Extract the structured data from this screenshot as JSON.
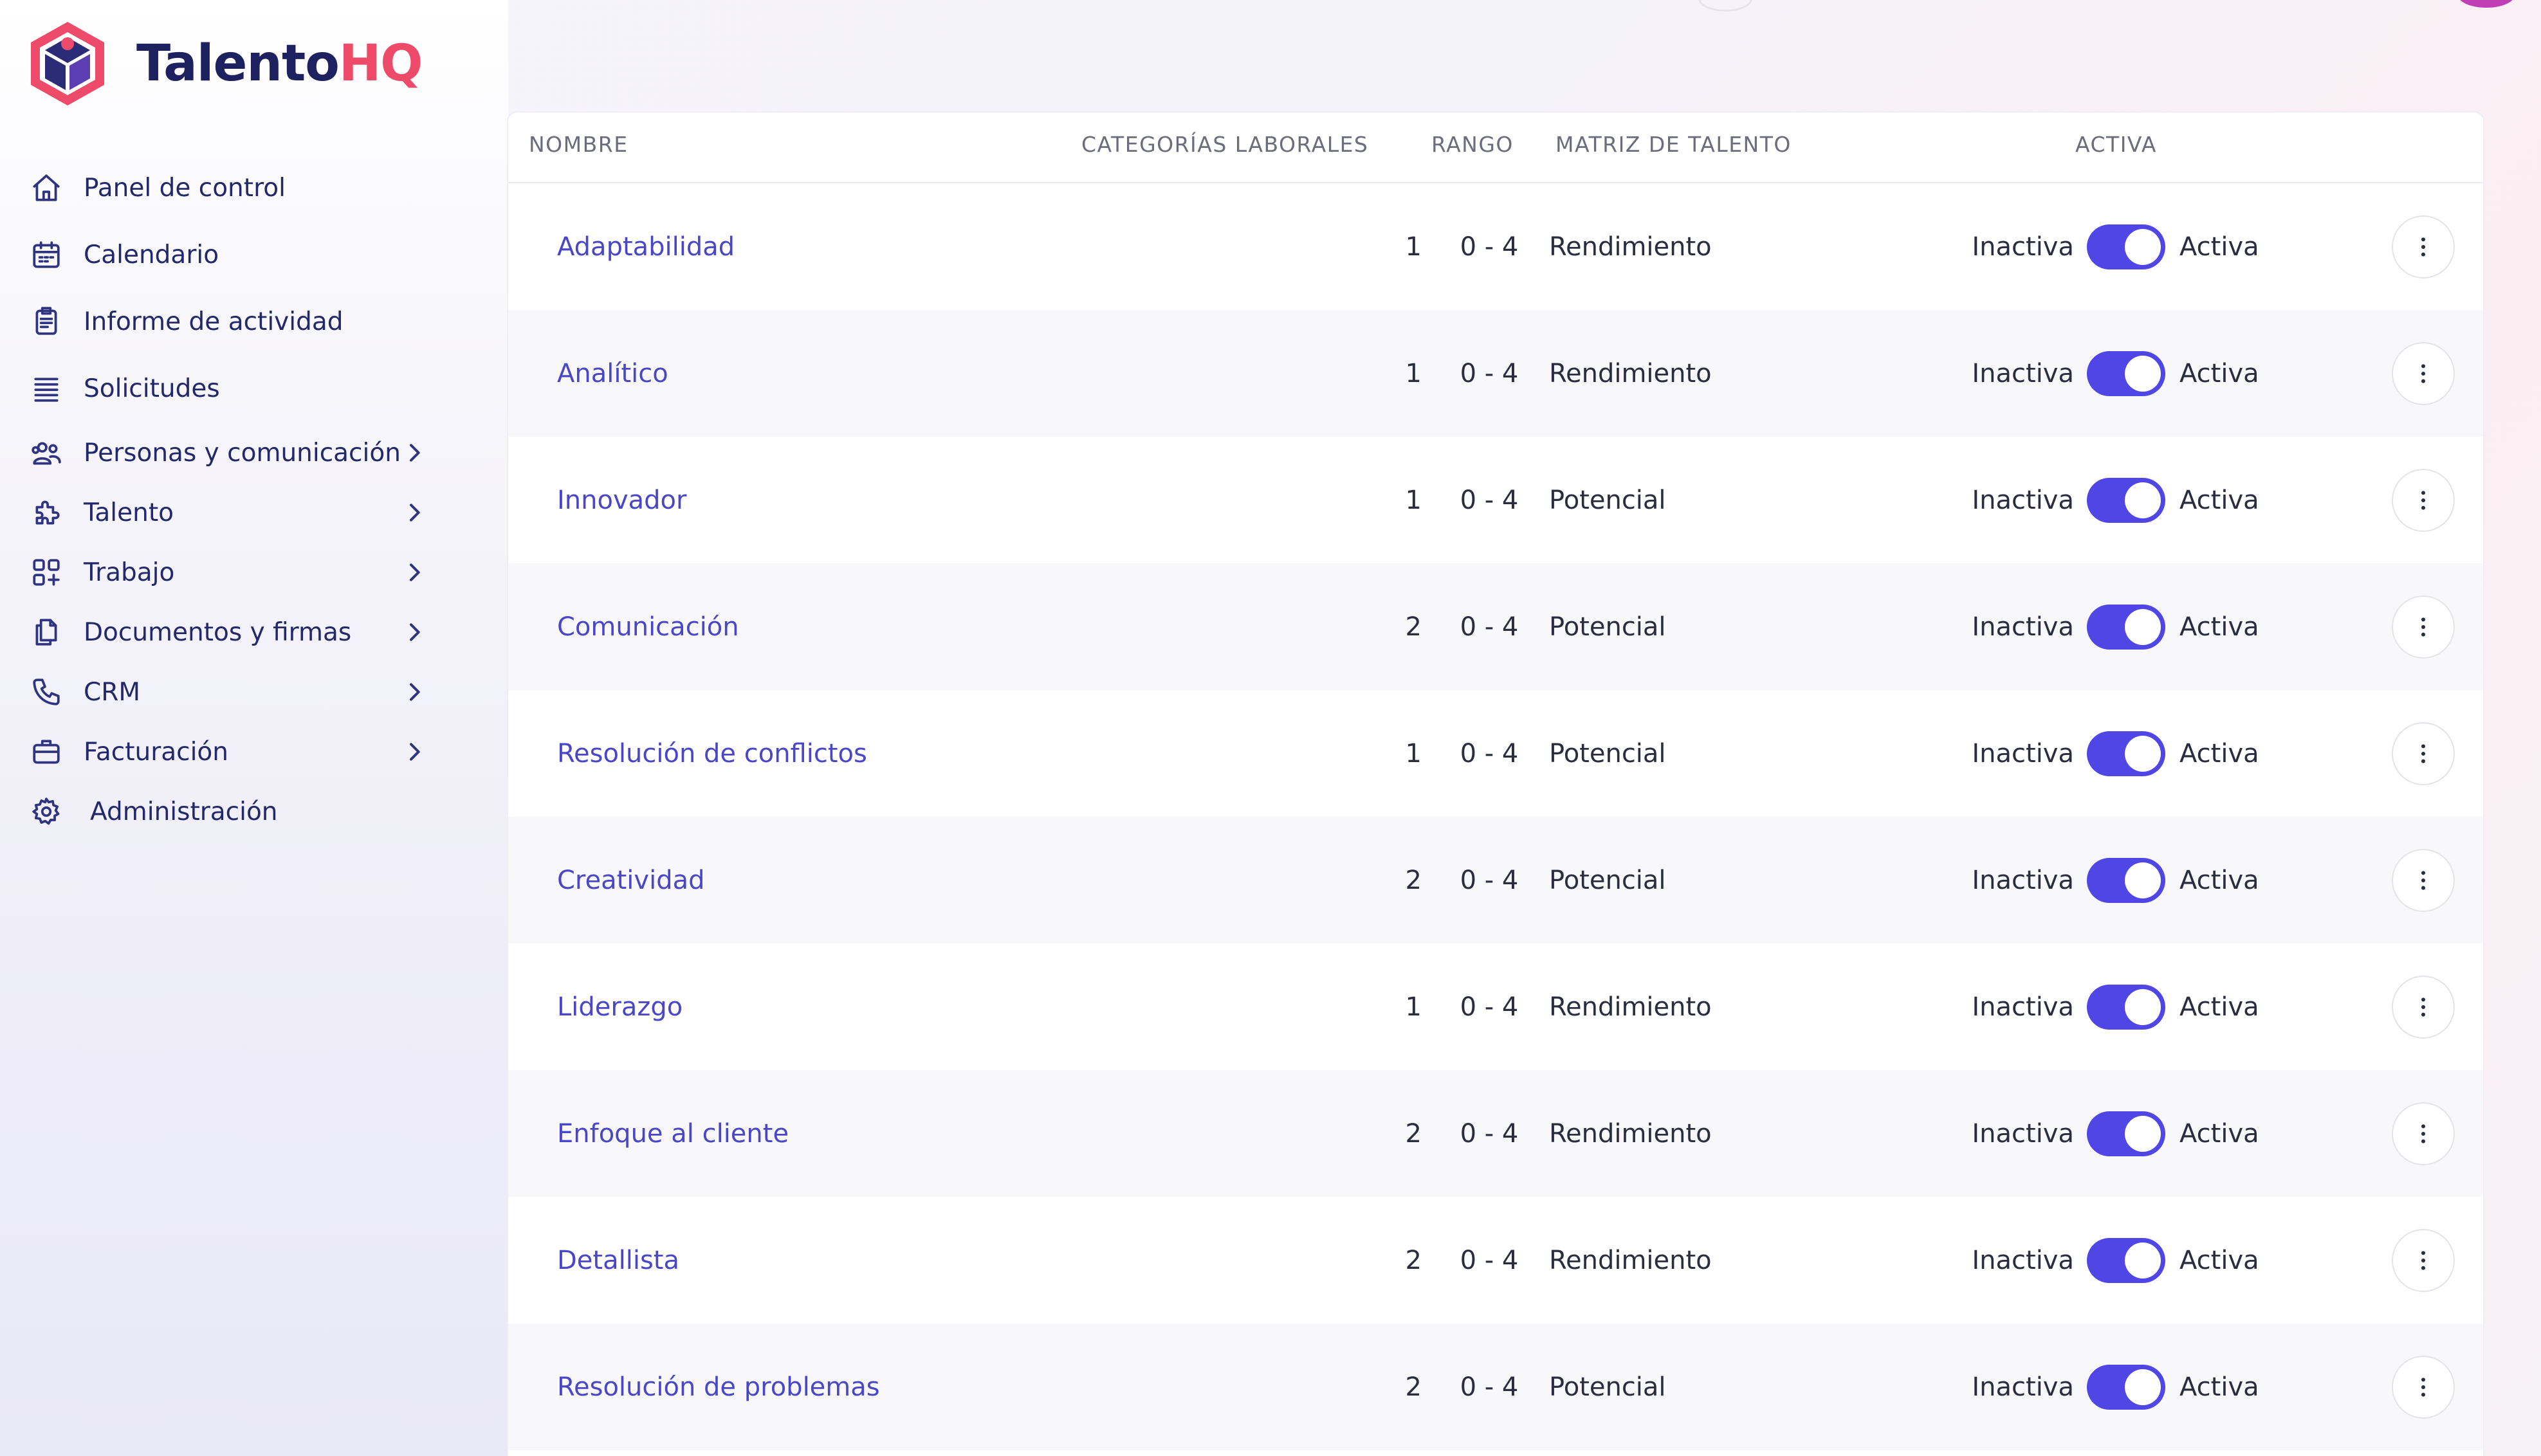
{
  "app": {
    "name_part1": "Talento",
    "name_part2": "HQ"
  },
  "sidebar": {
    "items": [
      {
        "label": "Panel de control",
        "icon": "home-icon"
      },
      {
        "label": "Calendario",
        "icon": "calendar-icon"
      },
      {
        "label": "Informe de actividad",
        "icon": "report-icon"
      },
      {
        "label": "Solicitudes",
        "icon": "list-icon"
      },
      {
        "label": "Personas y comunicación",
        "icon": "users-icon"
      },
      {
        "label": "Talento",
        "icon": "puzzle-icon"
      },
      {
        "label": "Trabajo",
        "icon": "grid-plus-icon"
      },
      {
        "label": "Documentos y firmas",
        "icon": "documents-icon"
      },
      {
        "label": "CRM",
        "icon": "phone-icon"
      },
      {
        "label": "Facturación",
        "icon": "briefcase-icon"
      },
      {
        "label": "Administración",
        "icon": "gear-icon"
      }
    ]
  },
  "table": {
    "headers": {
      "name": "NOMBRE",
      "categories": "CATEGORÍAS LABORALES",
      "range": "RANGO",
      "matrix": "MATRIZ DE TALENTO",
      "active": "ACTIVA"
    },
    "toggle_off_label": "Inactiva",
    "toggle_on_label": "Activa",
    "rows": [
      {
        "name": "Adaptabilidad",
        "categories": "1",
        "range": "0 - 4",
        "matrix": "Rendimiento",
        "active": true
      },
      {
        "name": "Analítico",
        "categories": "1",
        "range": "0 - 4",
        "matrix": "Rendimiento",
        "active": true
      },
      {
        "name": "Innovador",
        "categories": "1",
        "range": "0 - 4",
        "matrix": "Potencial",
        "active": true
      },
      {
        "name": "Comunicación",
        "categories": "2",
        "range": "0 - 4",
        "matrix": "Potencial",
        "active": true
      },
      {
        "name": "Resolución de conflictos",
        "categories": "1",
        "range": "0 - 4",
        "matrix": "Potencial",
        "active": true
      },
      {
        "name": "Creatividad",
        "categories": "2",
        "range": "0 - 4",
        "matrix": "Potencial",
        "active": true
      },
      {
        "name": "Liderazgo",
        "categories": "1",
        "range": "0 - 4",
        "matrix": "Rendimiento",
        "active": true
      },
      {
        "name": "Enfoque al cliente",
        "categories": "2",
        "range": "0 - 4",
        "matrix": "Rendimiento",
        "active": true
      },
      {
        "name": "Detallista",
        "categories": "2",
        "range": "0 - 4",
        "matrix": "Rendimiento",
        "active": true
      },
      {
        "name": "Resolución de problemas",
        "categories": "2",
        "range": "0 - 4",
        "matrix": "Potencial",
        "active": true
      }
    ]
  },
  "colors": {
    "accent": "#4f46e5",
    "link": "#4a46c8",
    "brand_dark": "#1e2160",
    "brand_pink": "#ee4b6a"
  }
}
